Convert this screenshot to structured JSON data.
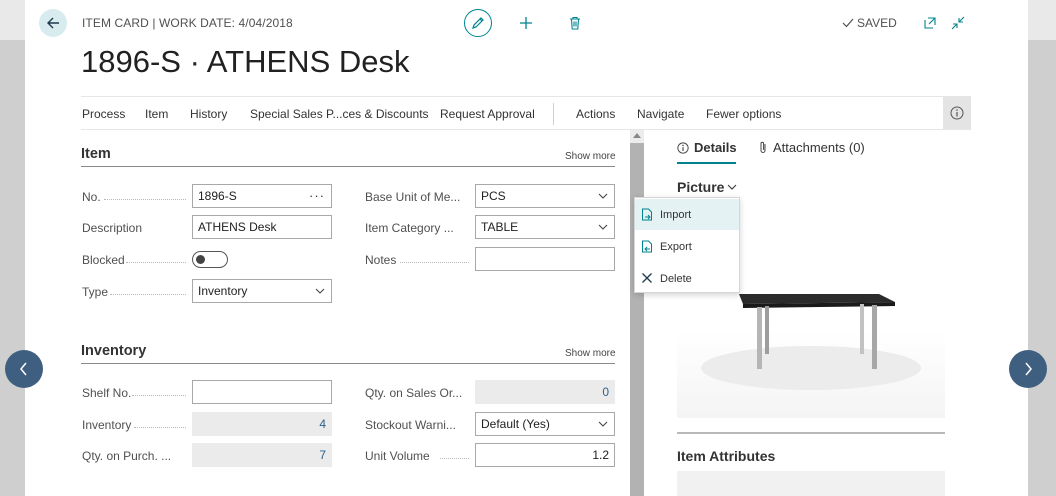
{
  "header": {
    "breadcrumb": "ITEM CARD | WORK DATE: 4/04/2018",
    "title": "1896-S · ATHENS Desk",
    "saved_label": "SAVED"
  },
  "actions": [
    "Process",
    "Item",
    "History",
    "Special Sales P...ces & Discounts",
    "Request Approval",
    "Actions",
    "Navigate",
    "Fewer options"
  ],
  "item_section": {
    "title": "Item",
    "show_more": "Show more",
    "fields": {
      "no_label": "No.",
      "no_value": "1896-S",
      "description_label": "Description",
      "description_value": "ATHENS Desk",
      "blocked_label": "Blocked",
      "blocked_value": false,
      "type_label": "Type",
      "type_value": "Inventory",
      "base_unit_label": "Base Unit of Me...",
      "base_unit_value": "PCS",
      "item_category_label": "Item Category ...",
      "item_category_value": "TABLE",
      "notes_label": "Notes",
      "notes_value": ""
    }
  },
  "inventory_section": {
    "title": "Inventory",
    "show_more": "Show more",
    "fields": {
      "shelf_no_label": "Shelf No.",
      "shelf_no_value": "",
      "inventory_label": "Inventory",
      "inventory_value": "4",
      "qty_purch_label": "Qty. on Purch. ...",
      "qty_purch_value": "7",
      "qty_sales_label": "Qty. on Sales Or...",
      "qty_sales_value": "0",
      "stockout_label": "Stockout Warni...",
      "stockout_value": "Default (Yes)",
      "unit_volume_label": "Unit Volume",
      "unit_volume_value": "1.2"
    }
  },
  "factbox": {
    "tab_details": "Details",
    "tab_attachments": "Attachments (0)",
    "picture_title": "Picture",
    "picture_menu": [
      "Import",
      "Export",
      "Delete"
    ],
    "attributes_title": "Item Attributes"
  },
  "colors": {
    "accent": "#00838f",
    "nav_button": "#3f5f80"
  }
}
